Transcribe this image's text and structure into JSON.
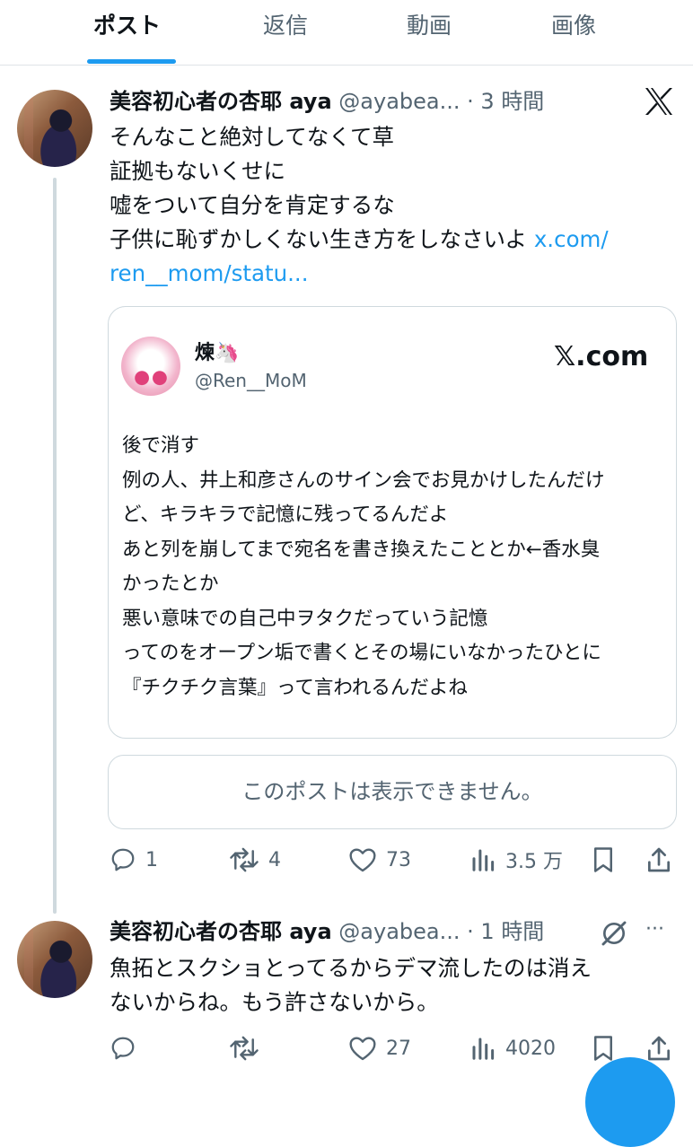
{
  "tabs": [
    {
      "label": "ポスト",
      "active": true
    },
    {
      "label": "返信",
      "active": false
    },
    {
      "label": "動画",
      "active": false
    },
    {
      "label": "画像",
      "active": false
    }
  ],
  "post1": {
    "name": "美容初心者の杏耶 aya",
    "handle": "@ayabea...",
    "time": "· 3 時間",
    "lines": [
      "そんなこと絶対してなくて草",
      "証拠もないくせに",
      "嘘をついて自分を肯定するな",
      "子供に恥ずかしくない生き方をしなさいよ"
    ],
    "link_part1": "x.com/",
    "link_part2": "ren__mom/statu...",
    "quote": {
      "name": "煉🦄",
      "handle": "@Ren__MoM",
      "brand": "𝕏.com",
      "lines": [
        "後で消す",
        "例の人、井上和彦さんのサイン会でお見かけしたんだけ",
        "ど、キラキラで記憶に残ってるんだよ",
        "あと列を崩してまで宛名を書き換えたこととか←香水臭",
        "かったとか",
        "悪い意味での自己中ヲタクだっていう記憶",
        "ってのをオープン垢で書くとその場にいなかったひとに",
        "『チクチク言葉』って言われるんだよね"
      ]
    },
    "unavailable": "このポストは表示できません。",
    "replies": "1",
    "reposts": "4",
    "likes": "73",
    "views": "3.5 万"
  },
  "post2": {
    "name": "美容初心者の杏耶 aya",
    "handle": "@ayabea...",
    "time": "· 1 時間",
    "more": "···",
    "lines": [
      "魚拓とスクショとってるからデマ流したのは消え",
      "ないからね。もう許さないから。"
    ],
    "replies": "",
    "reposts": "",
    "likes": "27",
    "views": "4020"
  },
  "colors": {
    "accent": "#1d9bf0",
    "secondary_text": "#536471",
    "border": "#cfd9de"
  }
}
